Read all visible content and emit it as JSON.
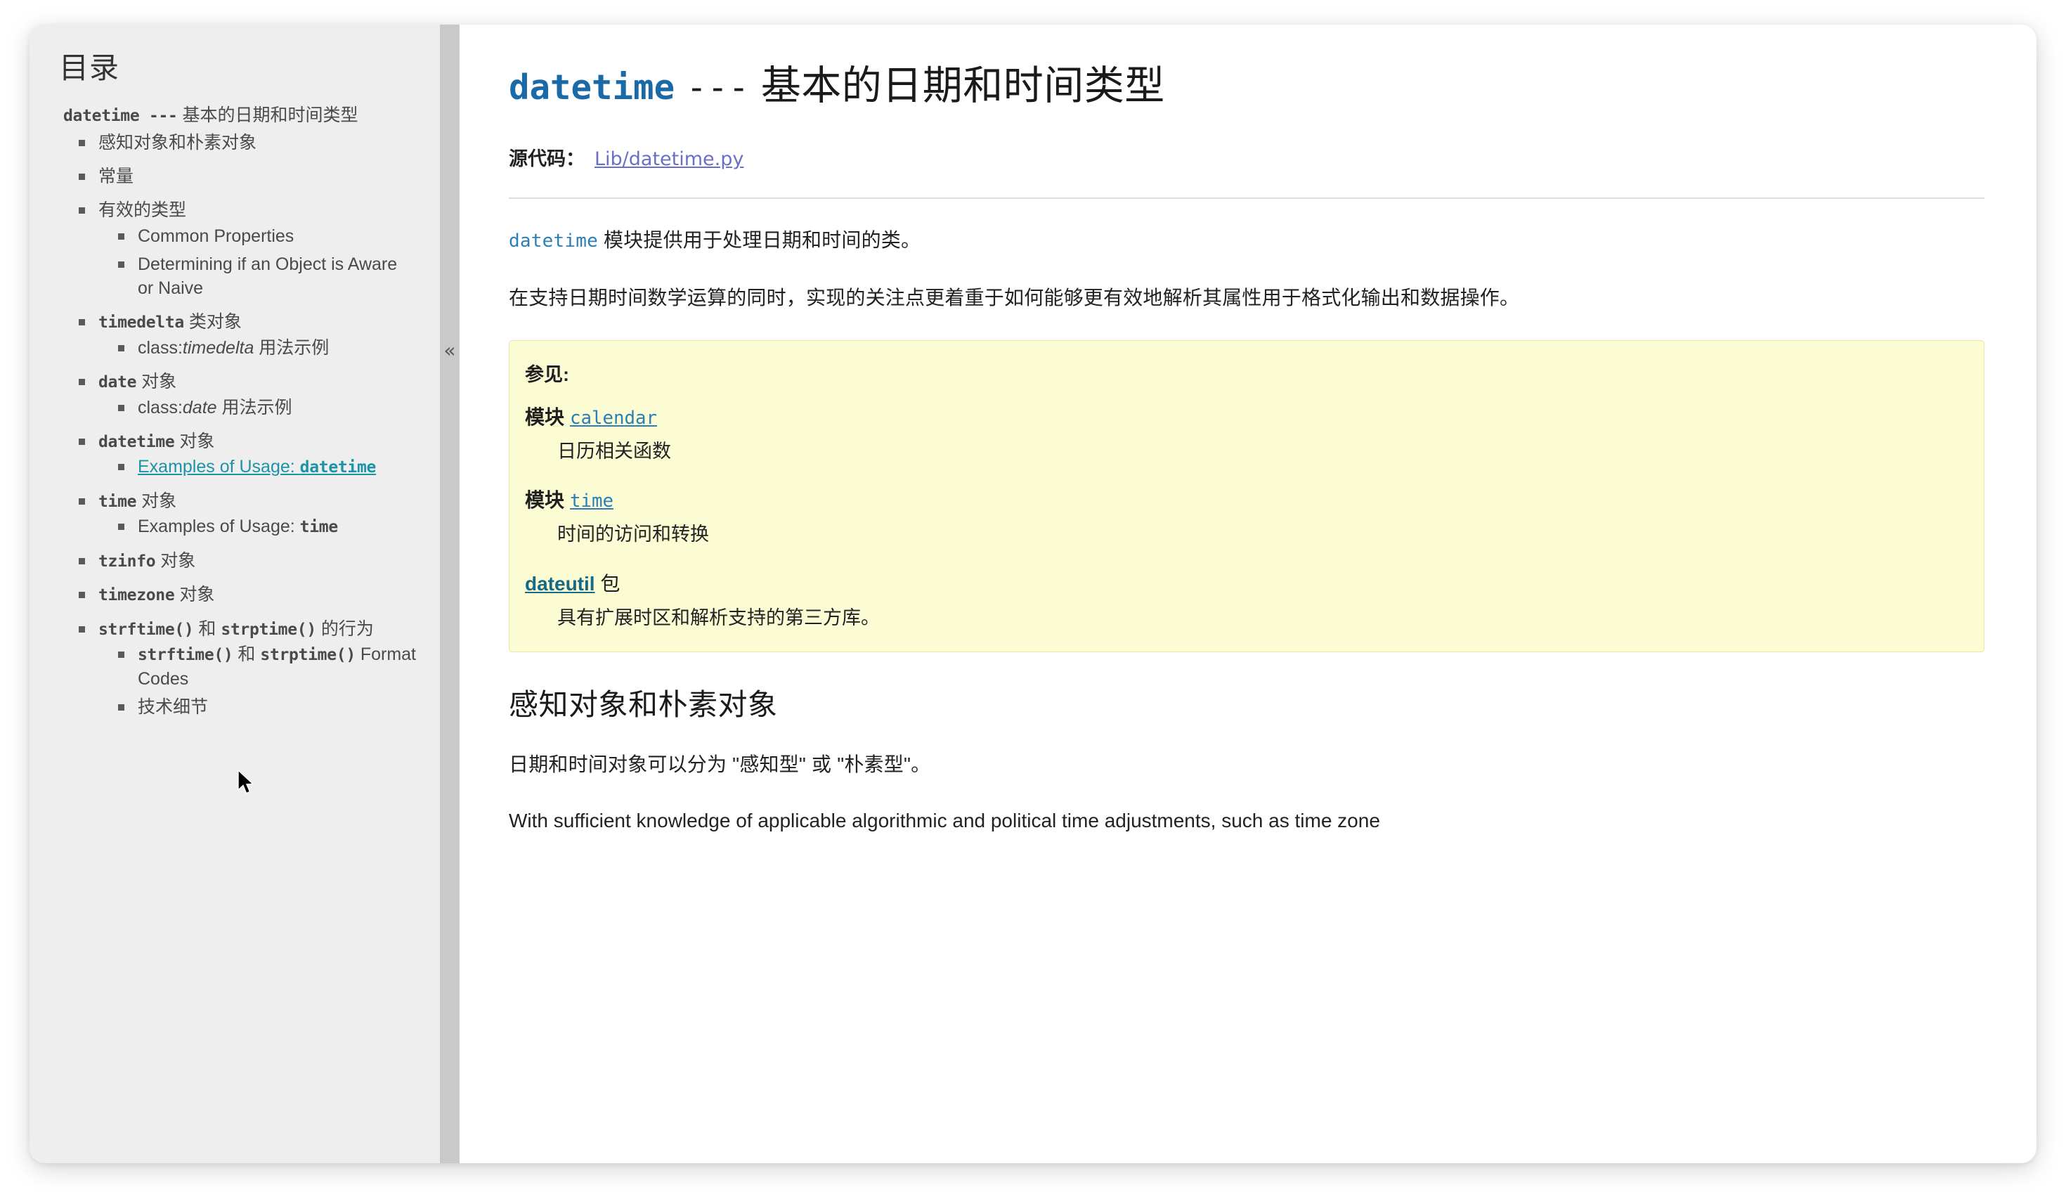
{
  "sidebar": {
    "title": "目录",
    "root_item": {
      "code": "datetime",
      "dashes": "---",
      "text": "基本的日期和时间类型"
    },
    "items": [
      {
        "level": 2,
        "label": "感知对象和朴素对象",
        "hovered": false
      },
      {
        "level": 2,
        "label": "常量",
        "hovered": false
      },
      {
        "level": 2,
        "label": "有效的类型",
        "hovered": false
      },
      {
        "level": 3,
        "label": "Common Properties",
        "hovered": false
      },
      {
        "level": 3,
        "label": "Determining if an Object is Aware or Naive",
        "hovered": false
      },
      {
        "level": 2,
        "code": "timedelta",
        "label": " 类对象",
        "hovered": false
      },
      {
        "level": 3,
        "pre": "class:",
        "italic": "timedelta",
        "label": " 用法示例",
        "hovered": false
      },
      {
        "level": 2,
        "code": "date",
        "label": " 对象",
        "hovered": false
      },
      {
        "level": 3,
        "pre": "class:",
        "italic": "date",
        "label": " 用法示例",
        "hovered": false
      },
      {
        "level": 2,
        "code": "datetime",
        "label": " 对象",
        "hovered": false
      },
      {
        "level": 3,
        "label": "Examples of Usage: ",
        "code_suffix": "datetime",
        "hovered": true
      },
      {
        "level": 2,
        "code": "time",
        "label": " 对象",
        "hovered": false
      },
      {
        "level": 3,
        "label": "Examples of Usage: ",
        "code_suffix": "time",
        "hovered": false
      },
      {
        "level": 2,
        "code": "tzinfo",
        "label": " 对象",
        "hovered": false
      },
      {
        "level": 2,
        "code": "timezone",
        "label": " 对象",
        "hovered": false
      },
      {
        "level": 2,
        "code": "strftime()",
        "label": " 和 ",
        "code2": "strptime()",
        "label2": " 的行为",
        "hovered": false
      },
      {
        "level": 3,
        "code": "strftime()",
        "label": " 和 ",
        "code2": "strptime()",
        "label2": " Format Codes",
        "hovered": false
      },
      {
        "level": 3,
        "label": "技术细节",
        "hovered": false
      }
    ],
    "collapse_icon": "«"
  },
  "main": {
    "title_code": "datetime",
    "title_dashes": "---",
    "title_text": "基本的日期和时间类型",
    "source_label": "源代码：",
    "source_link": "Lib/datetime.py",
    "para1_code": "datetime",
    "para1_text": " 模块提供用于处理日期和时间的类。",
    "para2": "在支持日期时间数学运算的同时，实现的关注点更着重于如何能够更有效地解析其属性用于格式化输出和数据操作。",
    "seealso": {
      "title": "参见:",
      "entries": [
        {
          "label": "模块",
          "name": "calendar",
          "style": "mono",
          "desc": "日历相关函数"
        },
        {
          "label": "模块",
          "name": "time",
          "style": "mono",
          "desc": "时间的访问和转换"
        },
        {
          "label": "",
          "name": "dateutil",
          "suffix": " 包",
          "style": "pkg",
          "desc": "具有扩展时区和解析支持的第三方库。"
        }
      ]
    },
    "section_title": "感知对象和朴素对象",
    "para3": "日期和时间对象可以分为 \"感知型\" 或 \"朴素型\"。",
    "para4": "With sufficient knowledge of applicable algorithmic and political time adjustments, such as time zone"
  },
  "colors": {
    "accent_blue": "#1a6aa8",
    "link_purple": "#6b70c4",
    "code_blue": "#2a7fb8",
    "hover_teal": "#1b94a8",
    "seealso_bg": "#fcfcd4",
    "sidebar_bg": "#eeeeee"
  }
}
